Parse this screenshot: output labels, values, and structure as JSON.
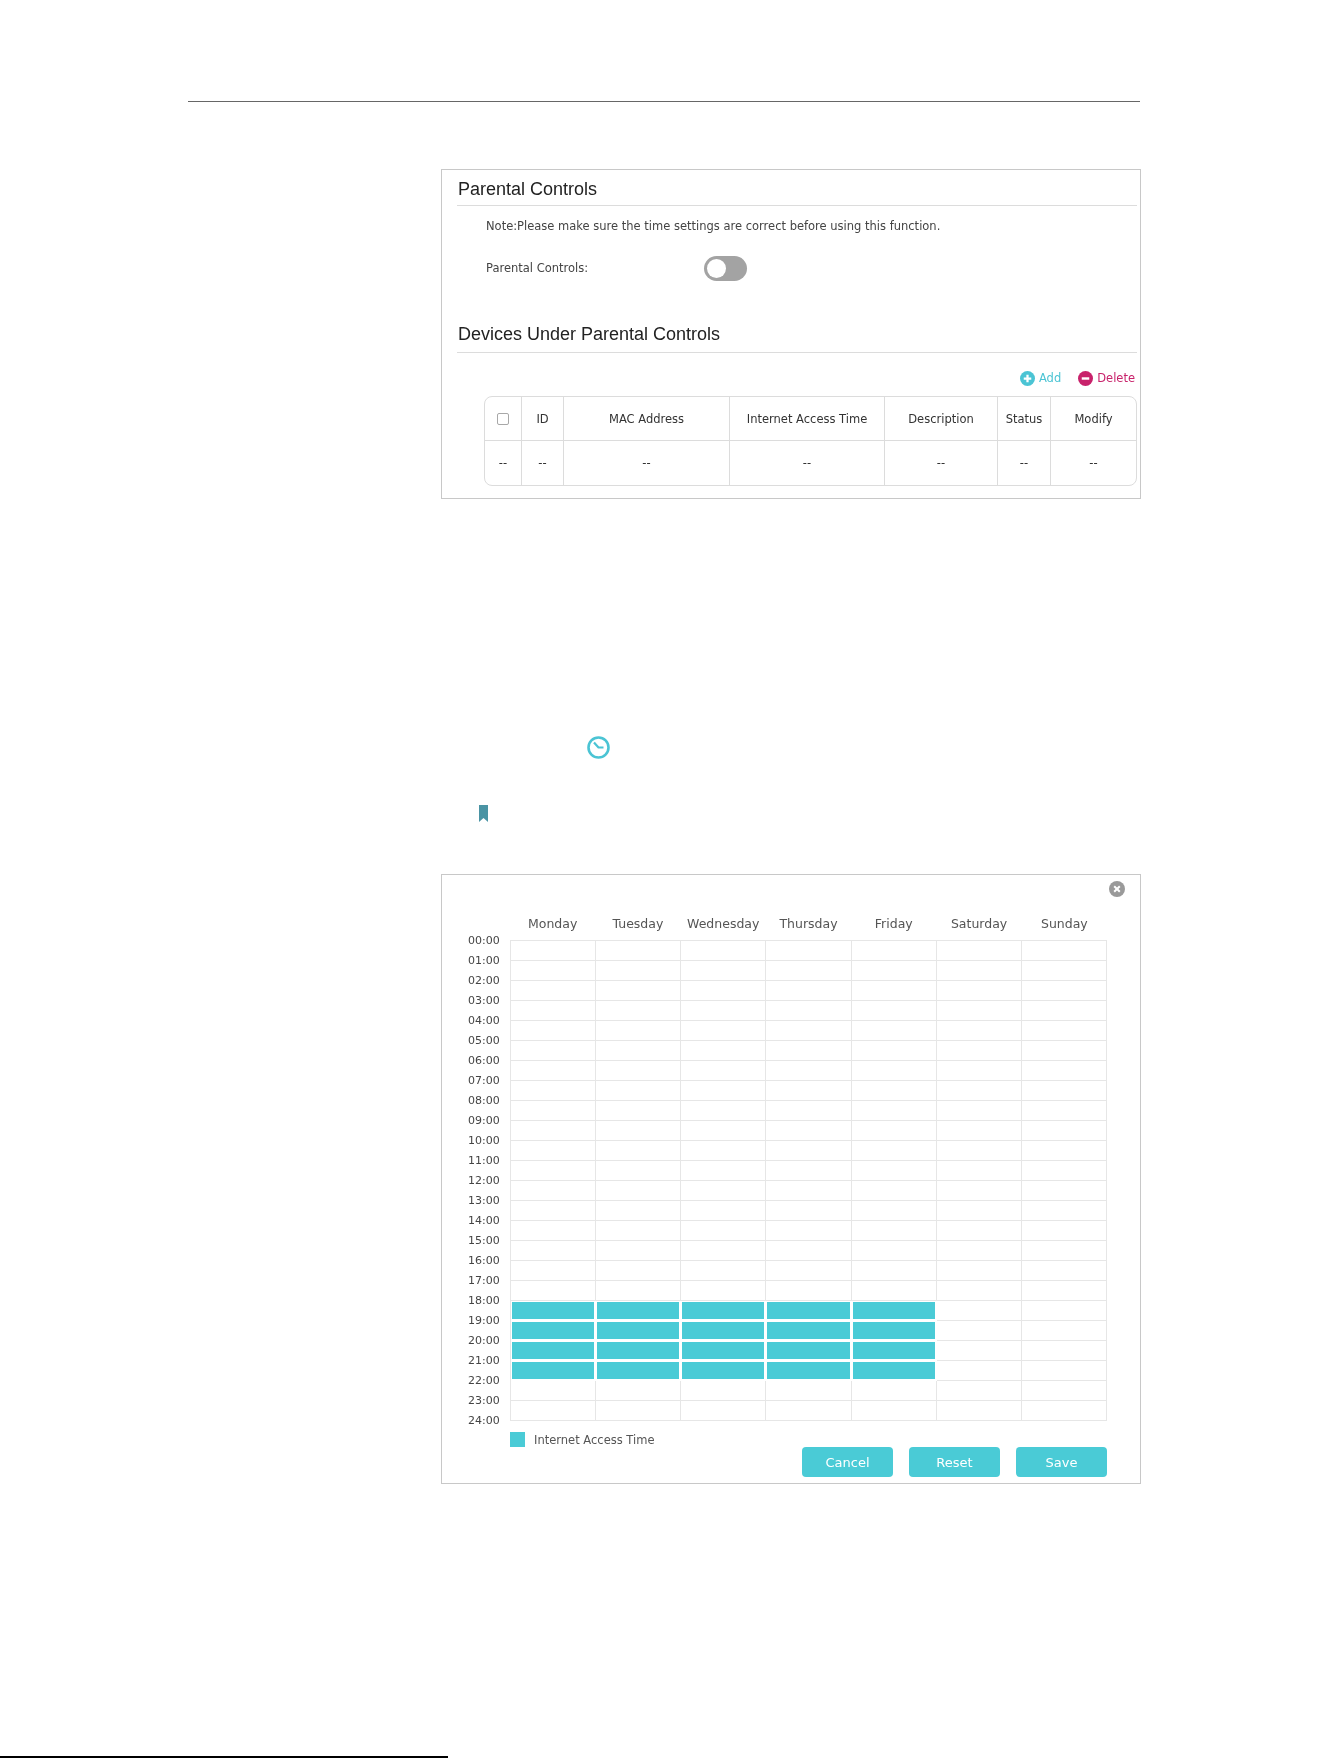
{
  "parental_controls": {
    "title": "Parental Controls",
    "note": "Note:Please make sure the time settings are correct before using this function.",
    "toggle": {
      "label": "Parental Controls:",
      "on": false
    }
  },
  "devices": {
    "title": "Devices Under Parental Controls",
    "actions": [
      {
        "kind": "add",
        "label": "Add"
      },
      {
        "kind": "delete",
        "label": "Delete"
      }
    ],
    "table": {
      "columns": [
        {
          "kind": "checkbox",
          "checked": false
        },
        {
          "kind": "label",
          "label": "ID"
        },
        {
          "kind": "label",
          "label": "MAC Address"
        },
        {
          "kind": "label",
          "label": "Internet Access Time"
        },
        {
          "kind": "label",
          "label": "Description"
        },
        {
          "kind": "label",
          "label": "Status"
        },
        {
          "kind": "label",
          "label": "Modify"
        }
      ],
      "rows": [
        [
          "--",
          "--",
          "--",
          "--",
          "--",
          "--",
          "--"
        ]
      ]
    }
  },
  "schedule": {
    "days": [
      "Monday",
      "Tuesday",
      "Wednesday",
      "Thursday",
      "Friday",
      "Saturday",
      "Sunday"
    ],
    "hours": [
      "00:00",
      "01:00",
      "02:00",
      "03:00",
      "04:00",
      "05:00",
      "06:00",
      "07:00",
      "08:00",
      "09:00",
      "10:00",
      "11:00",
      "12:00",
      "13:00",
      "14:00",
      "15:00",
      "16:00",
      "17:00",
      "18:00",
      "19:00",
      "20:00",
      "21:00",
      "22:00",
      "23:00",
      "24:00"
    ],
    "slots": [
      [
        false,
        false,
        false,
        false,
        false,
        false,
        false
      ],
      [
        false,
        false,
        false,
        false,
        false,
        false,
        false
      ],
      [
        false,
        false,
        false,
        false,
        false,
        false,
        false
      ],
      [
        false,
        false,
        false,
        false,
        false,
        false,
        false
      ],
      [
        false,
        false,
        false,
        false,
        false,
        false,
        false
      ],
      [
        false,
        false,
        false,
        false,
        false,
        false,
        false
      ],
      [
        false,
        false,
        false,
        false,
        false,
        false,
        false
      ],
      [
        false,
        false,
        false,
        false,
        false,
        false,
        false
      ],
      [
        false,
        false,
        false,
        false,
        false,
        false,
        false
      ],
      [
        false,
        false,
        false,
        false,
        false,
        false,
        false
      ],
      [
        false,
        false,
        false,
        false,
        false,
        false,
        false
      ],
      [
        false,
        false,
        false,
        false,
        false,
        false,
        false
      ],
      [
        false,
        false,
        false,
        false,
        false,
        false,
        false
      ],
      [
        false,
        false,
        false,
        false,
        false,
        false,
        false
      ],
      [
        false,
        false,
        false,
        false,
        false,
        false,
        false
      ],
      [
        false,
        false,
        false,
        false,
        false,
        false,
        false
      ],
      [
        false,
        false,
        false,
        false,
        false,
        false,
        false
      ],
      [
        false,
        false,
        false,
        false,
        false,
        false,
        false
      ],
      [
        true,
        true,
        true,
        true,
        true,
        false,
        false
      ],
      [
        true,
        true,
        true,
        true,
        true,
        false,
        false
      ],
      [
        true,
        true,
        true,
        true,
        true,
        false,
        false
      ],
      [
        true,
        true,
        true,
        true,
        true,
        false,
        false
      ],
      [
        false,
        false,
        false,
        false,
        false,
        false,
        false
      ],
      [
        false,
        false,
        false,
        false,
        false,
        false,
        false
      ]
    ],
    "legend": "Internet Access Time",
    "buttons": [
      "Cancel",
      "Reset",
      "Save"
    ]
  }
}
